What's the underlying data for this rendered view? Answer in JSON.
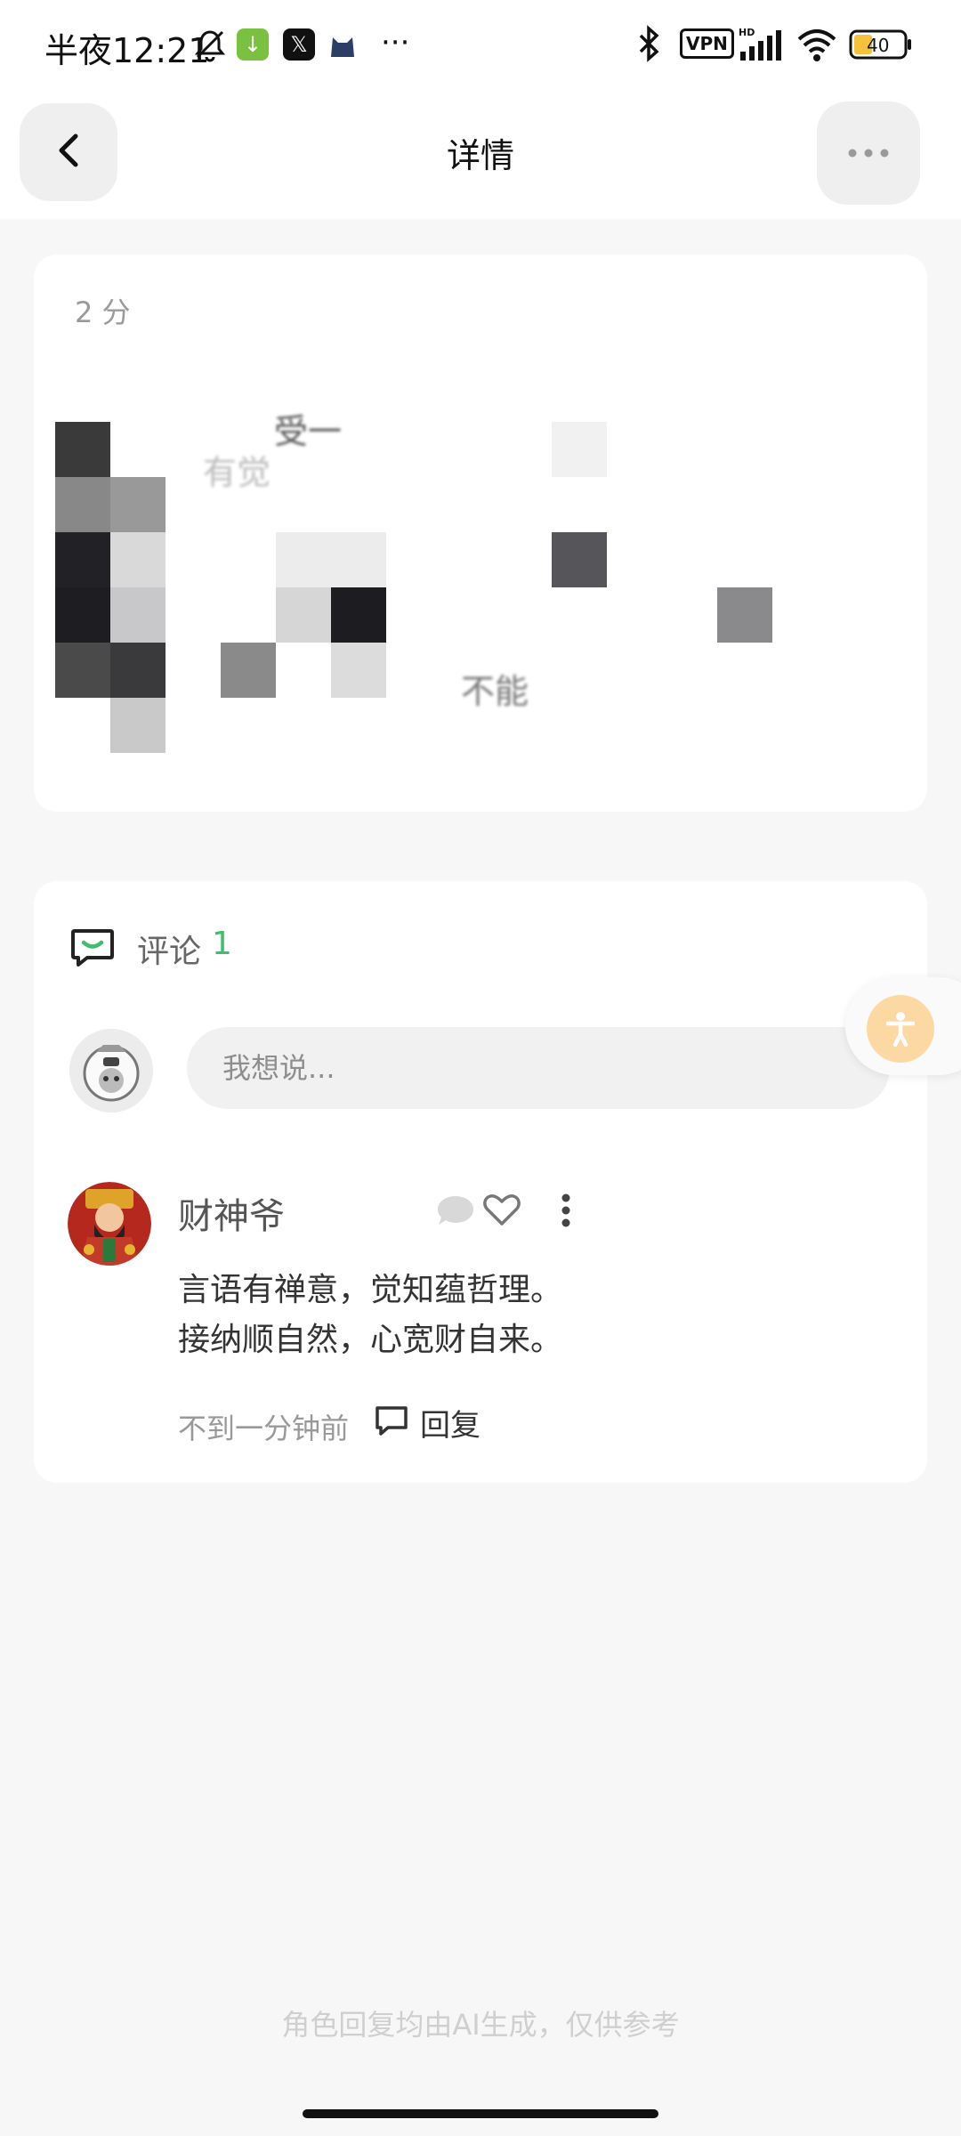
{
  "status_bar": {
    "time": "半夜12:21",
    "vpn": "VPN",
    "hd": "HD",
    "battery": "40",
    "more": "···"
  },
  "nav": {
    "title": "详情"
  },
  "post": {
    "time_partial": "2 分",
    "fragment_1": "受一",
    "fragment_2": "有觉",
    "fragment_3": "不能"
  },
  "comments": {
    "label": "评论",
    "count": "1",
    "input_placeholder": "我想说...",
    "items": [
      {
        "author": "财神爷",
        "line1": "言语有禅意，觉知蕴哲理。",
        "line2": "接纳顺自然，心宽财自来。",
        "time": "不到一分钟前",
        "reply_label": "回复"
      }
    ]
  },
  "disclaimer": "角色回复均由AI生成，仅供参考",
  "colors": {
    "accent_green": "#3fbf6e",
    "a11y_orange": "#fcd9a3"
  }
}
